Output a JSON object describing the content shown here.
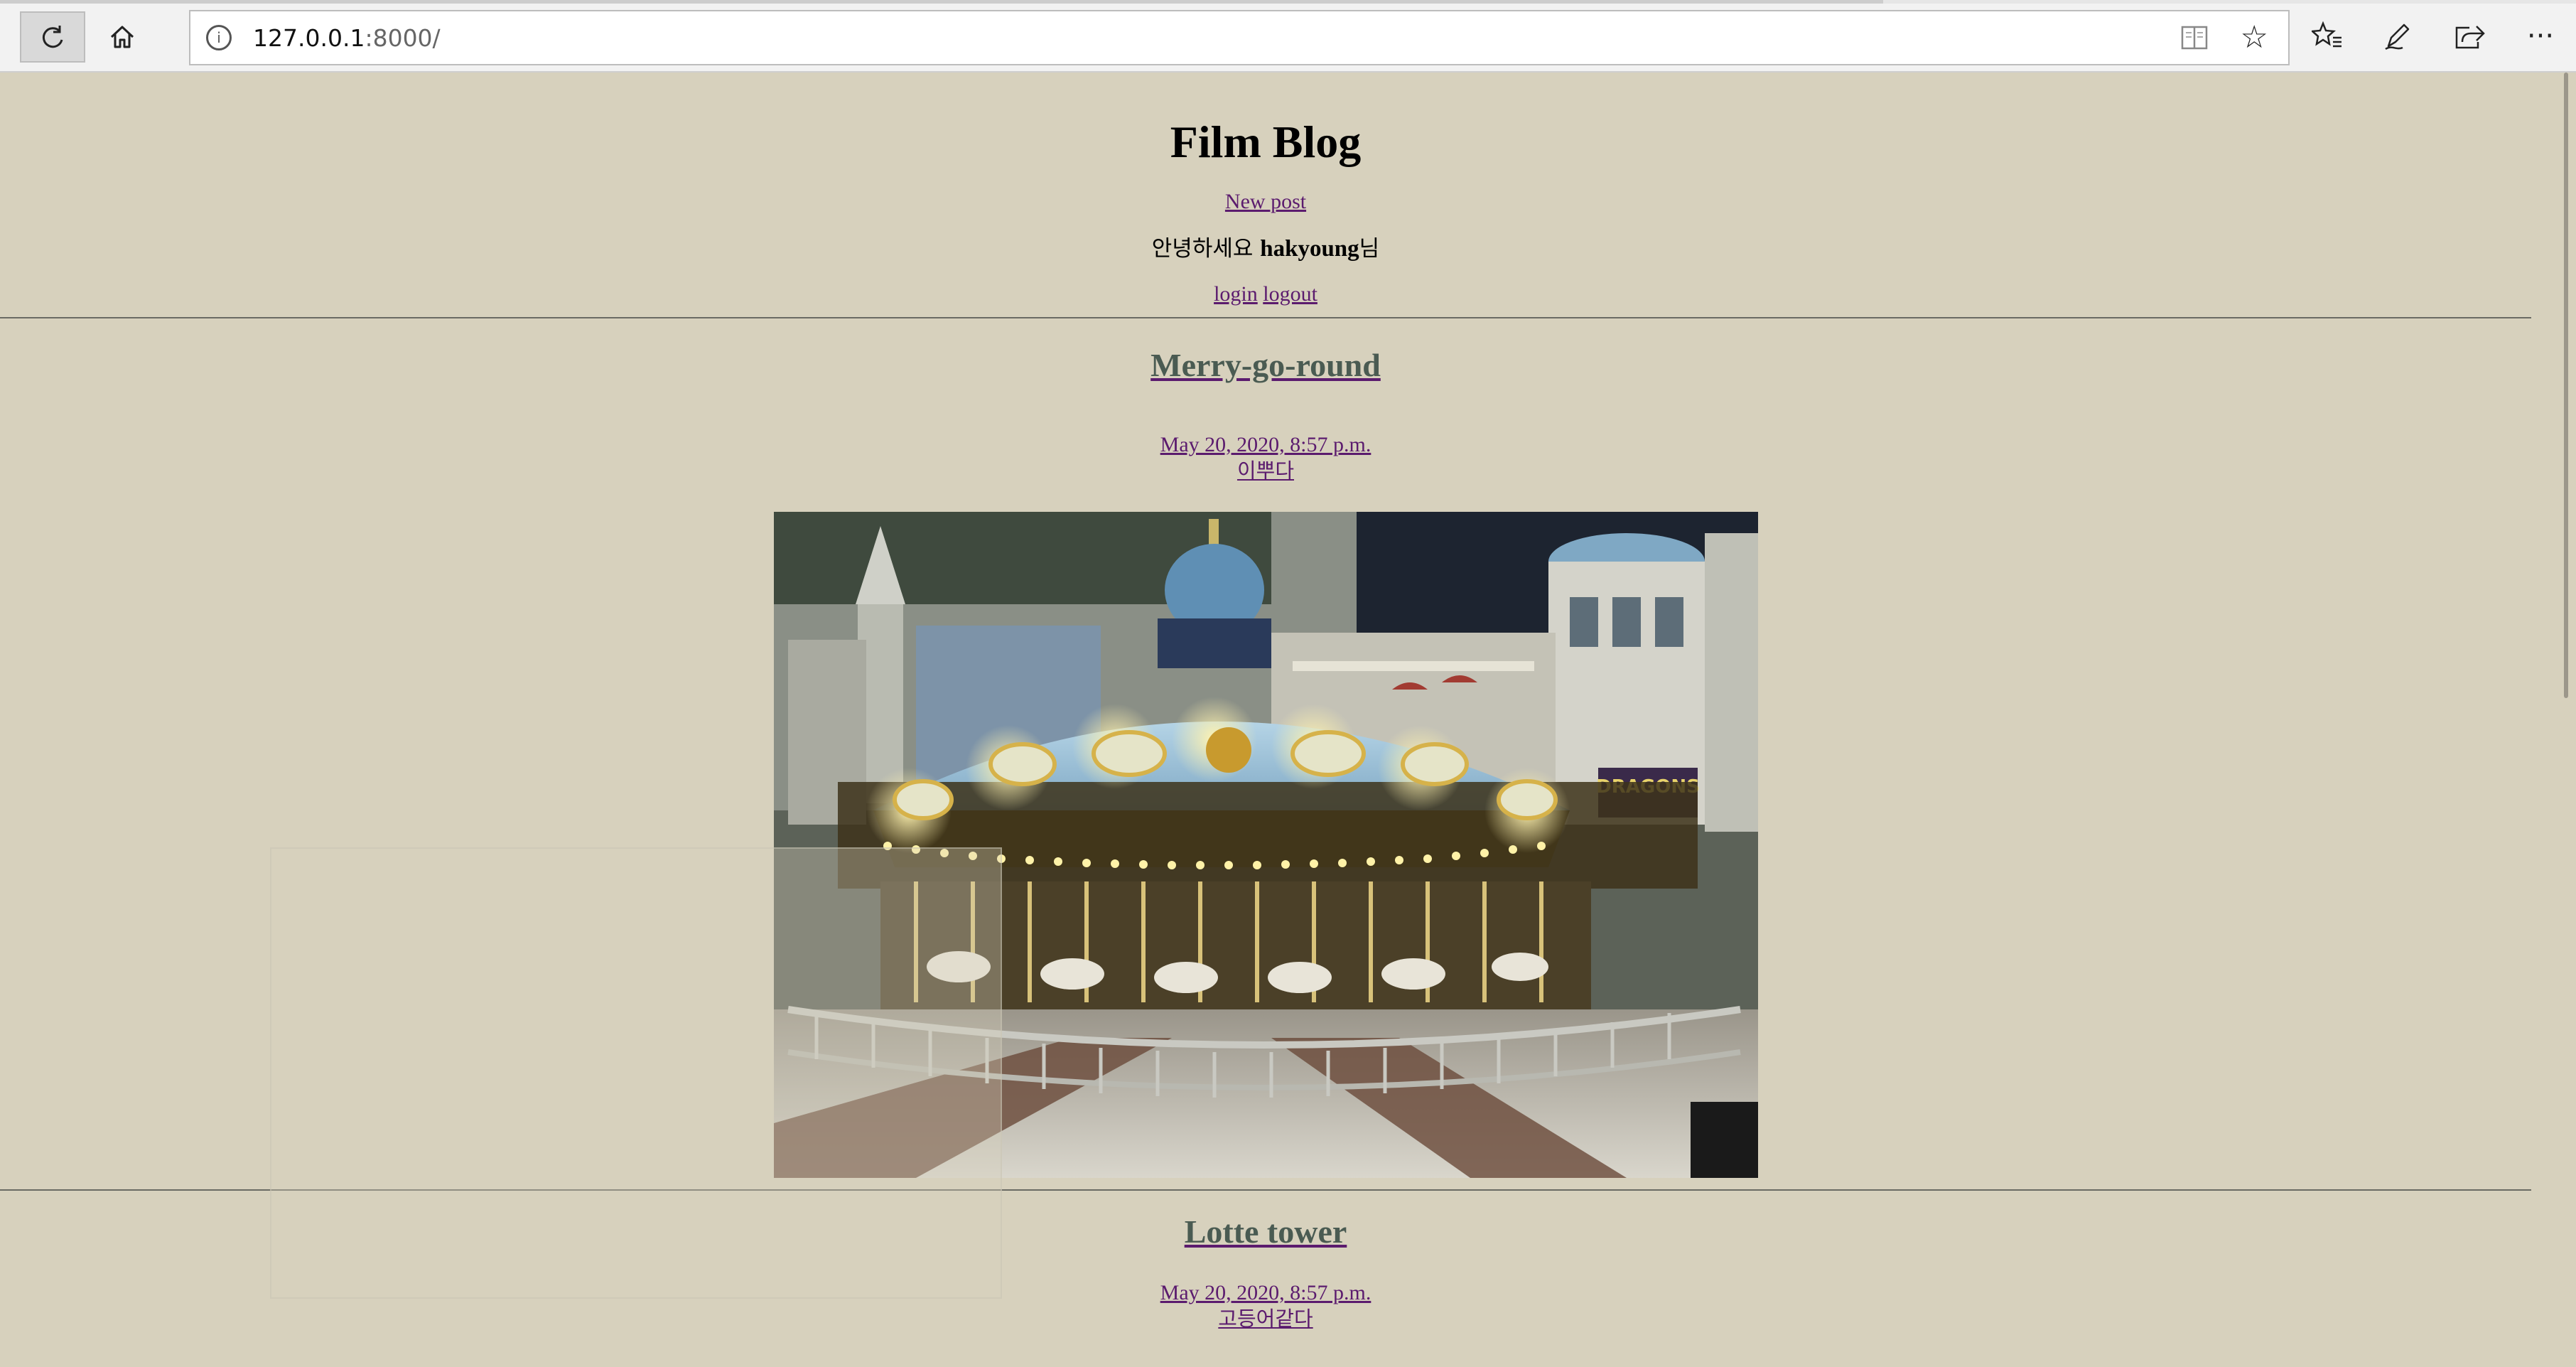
{
  "browser": {
    "url_host": "127.0.0.1",
    "url_port_path": ":8000/",
    "icons": {
      "refresh": "refresh-icon",
      "home": "home-icon",
      "info": "info-icon",
      "reading_view": "reading-view-icon",
      "favorite": "star-icon",
      "favorites_list": "favorites-list-icon",
      "pen": "pen-icon",
      "share": "share-icon",
      "more": "more-icon"
    }
  },
  "site": {
    "title": "Film Blog",
    "new_post_label": "New post",
    "greeting_prefix": "안녕하세요 ",
    "username": "hakyoung",
    "greeting_suffix": "님",
    "login_label": "login",
    "logout_label": "logout",
    "background_color": "#d7d1bd",
    "link_color": "#5b1b6e"
  },
  "posts": [
    {
      "title": "Merry-go-round",
      "date": "May 20, 2020, 8:57 p.m.",
      "body": "이뿌다",
      "image": "carousel-photo"
    },
    {
      "title": "Lotte tower",
      "date": "May 20, 2020, 8:57 p.m.",
      "body": "고등어같다"
    }
  ]
}
